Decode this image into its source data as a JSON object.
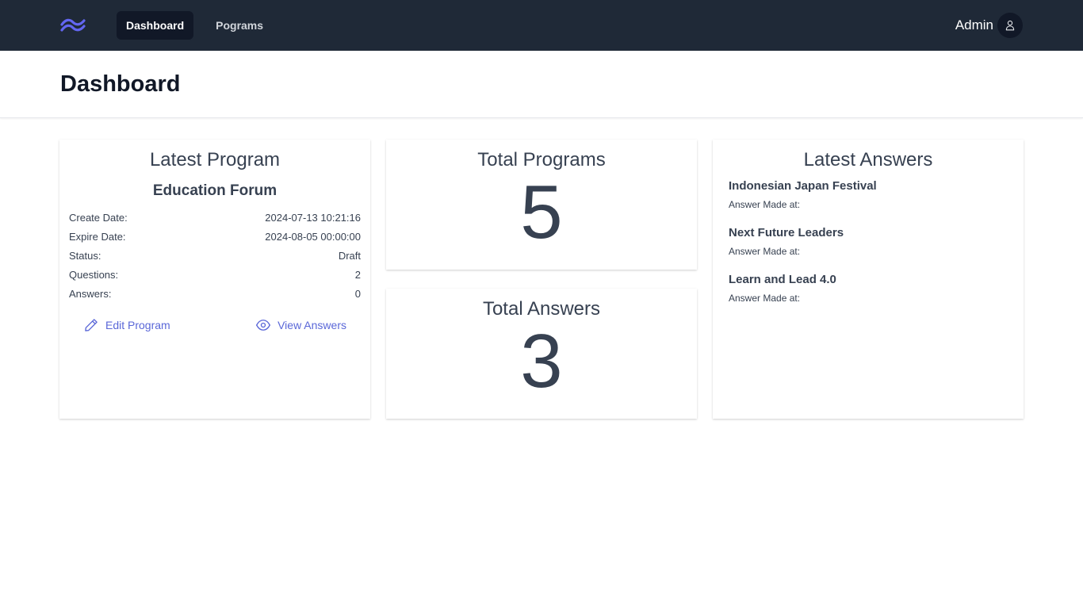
{
  "nav": {
    "logo": "tailwind-logo-icon",
    "items": [
      {
        "label": "Dashboard",
        "active": true
      },
      {
        "label": "Pograms",
        "active": false
      }
    ],
    "user_name": "Admin",
    "avatar_icon": "user-icon"
  },
  "header": {
    "title": "Dashboard"
  },
  "latest_program": {
    "title": "Latest Program",
    "name": "Education Forum",
    "fields": [
      {
        "label": "Create Date:",
        "value": "2024-07-13 10:21:16"
      },
      {
        "label": "Expire Date:",
        "value": "2024-08-05 00:00:00"
      },
      {
        "label": "Status:",
        "value": "Draft"
      },
      {
        "label": "Questions:",
        "value": "2"
      },
      {
        "label": "Answers:",
        "value": "0"
      }
    ],
    "edit_label": "Edit Program",
    "view_label": "View Answers"
  },
  "total_programs": {
    "title": "Total Programs",
    "value": "5"
  },
  "total_answers": {
    "title": "Total Answers",
    "value": "3"
  },
  "latest_answers": {
    "title": "Latest Answers",
    "items": [
      {
        "title": "Indonesian Japan Festival",
        "meta": "Answer Made at:"
      },
      {
        "title": "Next Future Leaders",
        "meta": "Answer Made at:"
      },
      {
        "title": "Learn and Lead 4.0",
        "meta": "Answer Made at:"
      }
    ]
  },
  "colors": {
    "nav_bg": "#1f2937",
    "accent": "#5a67d8",
    "logo": "#6366f1"
  }
}
